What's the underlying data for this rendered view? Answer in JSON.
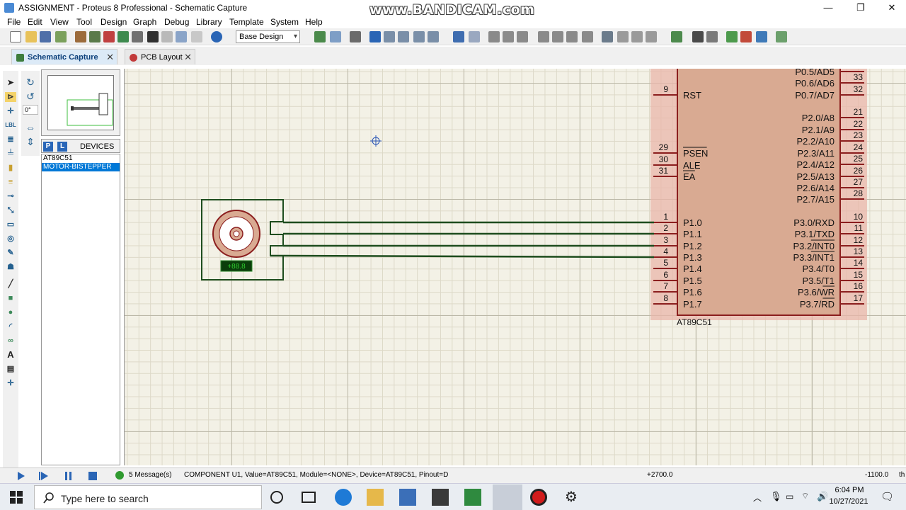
{
  "window": {
    "title": "ASSIGNMENT - Proteus 8 Professional - Schematic Capture",
    "watermark": "www.BANDICAM.com",
    "minimize": "—",
    "maximize": "❐",
    "close": "✕"
  },
  "menu": [
    "File",
    "Edit",
    "View",
    "Tool",
    "Design",
    "Graph",
    "Debug",
    "Library",
    "Template",
    "System",
    "Help"
  ],
  "toolbar": {
    "design_select": "Base Design"
  },
  "tabs": [
    {
      "label": "Schematic Capture",
      "active": true
    },
    {
      "label": "PCB Layout",
      "active": false
    }
  ],
  "tab_close": "✕",
  "rotation": {
    "angle": "0°"
  },
  "devices": {
    "p_button": "P",
    "l_button": "L",
    "heading": "DEVICES",
    "items": [
      {
        "name": "AT89C51",
        "selected": false
      },
      {
        "name": "MOTOR-BISTEPPER",
        "selected": true
      }
    ]
  },
  "schematic": {
    "chip_label": "AT89C51",
    "motor_display": "+88.8",
    "left_pins": [
      {
        "num": "9",
        "name": "RST"
      },
      {
        "num": "29",
        "name": "PSEN"
      },
      {
        "num": "30",
        "name": "ALE"
      },
      {
        "num": "31",
        "name": "EA"
      },
      {
        "num": "1",
        "name": "P1.0"
      },
      {
        "num": "2",
        "name": "P1.1"
      },
      {
        "num": "3",
        "name": "P1.2"
      },
      {
        "num": "4",
        "name": "P1.3"
      },
      {
        "num": "5",
        "name": "P1.4"
      },
      {
        "num": "6",
        "name": "P1.5"
      },
      {
        "num": "7",
        "name": "P1.6"
      },
      {
        "num": "8",
        "name": "P1.7"
      }
    ],
    "right_pins": [
      {
        "num": "",
        "name": "P0.5/AD5"
      },
      {
        "num": "33",
        "name": "P0.6/AD6"
      },
      {
        "num": "32",
        "name": "P0.7/AD7"
      },
      {
        "num": "21",
        "name": "P2.0/A8"
      },
      {
        "num": "22",
        "name": "P2.1/A9"
      },
      {
        "num": "23",
        "name": "P2.2/A10"
      },
      {
        "num": "24",
        "name": "P2.3/A11"
      },
      {
        "num": "25",
        "name": "P2.4/A12"
      },
      {
        "num": "26",
        "name": "P2.5/A13"
      },
      {
        "num": "27",
        "name": "P2.6/A14"
      },
      {
        "num": "28",
        "name": "P2.7/A15"
      },
      {
        "num": "10",
        "name": "P3.0/RXD"
      },
      {
        "num": "11",
        "name": "P3.1/TXD"
      },
      {
        "num": "12",
        "name": "P3.2/INT0"
      },
      {
        "num": "13",
        "name": "P3.3/INT1"
      },
      {
        "num": "14",
        "name": "P3.4/T0"
      },
      {
        "num": "15",
        "name": "P3.5/T1"
      },
      {
        "num": "16",
        "name": "P3.6/WR"
      },
      {
        "num": "17",
        "name": "P3.7/RD"
      }
    ]
  },
  "status": {
    "messages": "5 Message(s)",
    "component": "COMPONENT U1, Value=AT89C51, Module=<NONE>, Device=AT89C51, Pinout=D",
    "x": "+2700.0",
    "y": "-1100.0",
    "unit": "th"
  },
  "taskbar": {
    "search_placeholder": "Type here to search",
    "time": "6:04 PM",
    "date": "10/27/2021"
  },
  "colors": {
    "accent": "#0078d7",
    "chip_fill": "#d9aa92",
    "chip_outline": "#8b1e1e",
    "wire": "#1e4d1e",
    "canvas": "#f3f1e6"
  }
}
